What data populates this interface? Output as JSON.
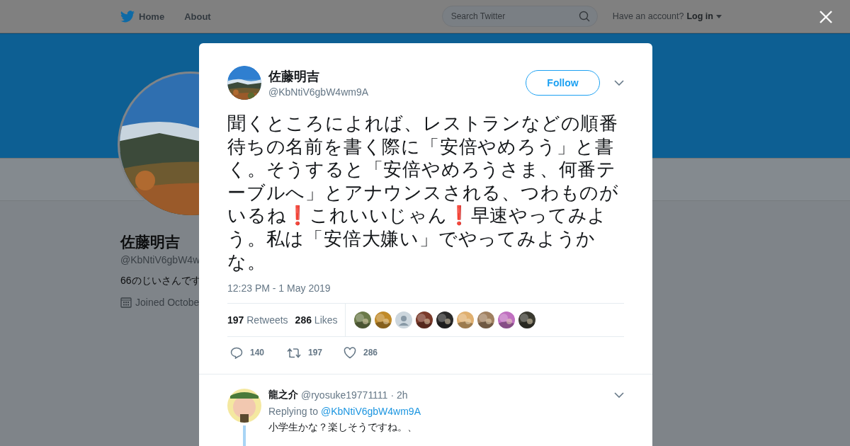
{
  "top_nav": {
    "home": "Home",
    "about": "About",
    "search_placeholder": "Search Twitter",
    "account_prompt": "Have an account?",
    "login": "Log in"
  },
  "profile": {
    "name": "佐藤明吉",
    "handle": "@KbNtiV6gbW4w",
    "bio": "66のじいさんです",
    "joined": "Joined Octobe"
  },
  "tweet": {
    "name": "佐藤明吉",
    "handle": "@KbNtiV6gbW4wm9A",
    "follow": "Follow",
    "text": [
      {
        "kind": "text",
        "text": "聞くところによれば、レストランなどの順番待ちの名前を書く際に「安倍やめろう」と書く。そうすると「安倍やめろうさま、何番テーブルへ」とアナウンスされる、つわものがいるね"
      },
      {
        "kind": "emoji",
        "text": "❗"
      },
      {
        "kind": "text",
        "text": "これいいじゃん"
      },
      {
        "kind": "emoji",
        "text": "❗"
      },
      {
        "kind": "text",
        "text": "早速やってみよう。私は「安倍大嫌い」でやってみようかな。"
      }
    ],
    "timestamp": "12:23 PM - 1 May 2019",
    "retweets": {
      "count": "197",
      "label": "Retweets"
    },
    "likes": {
      "count": "286",
      "label": "Likes"
    },
    "likers": [
      {
        "kind": "picture"
      },
      {
        "kind": "picture"
      },
      {
        "kind": "default"
      },
      {
        "kind": "picture"
      },
      {
        "kind": "picture"
      },
      {
        "kind": "picture"
      },
      {
        "kind": "picture"
      },
      {
        "kind": "picture"
      },
      {
        "kind": "picture"
      }
    ],
    "actions": [
      {
        "kind": "reply",
        "count": "140"
      },
      {
        "kind": "retweet",
        "count": "197"
      },
      {
        "kind": "like",
        "count": "286"
      }
    ]
  },
  "reply": {
    "name": "龍之介",
    "handle": "@ryosuke19771111",
    "time": "· 2h",
    "replying_to": "Replying to",
    "mention": "@KbNtiV6gbW4wm9A",
    "text": "小学生かな？楽しそうですね。、"
  }
}
